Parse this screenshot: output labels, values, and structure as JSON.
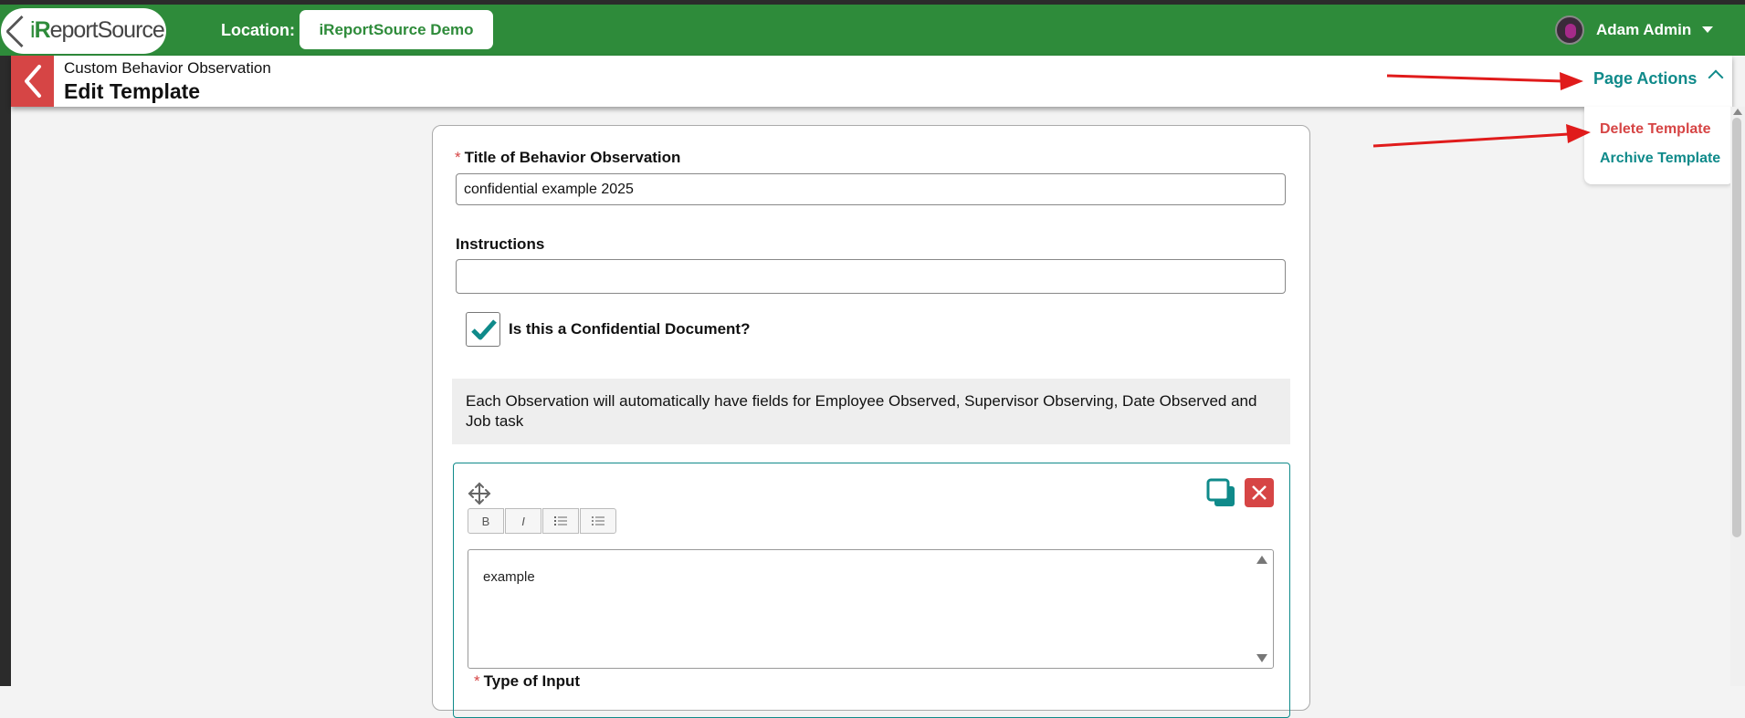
{
  "header": {
    "logo_text": "iReportSource",
    "location_label": "Location:",
    "location_value": "iReportSource Demo",
    "user_name": "Adam Admin"
  },
  "subheader": {
    "subtitle": "Custom Behavior Observation",
    "title": "Edit Template",
    "page_actions_label": "Page Actions"
  },
  "page_actions_menu": {
    "items": [
      {
        "label": "Delete Template",
        "color": "#d64545"
      },
      {
        "label": "Archive Template",
        "color": "#0f8a8a"
      }
    ]
  },
  "form": {
    "title_label": "Title of Behavior Observation",
    "required_mark": "*",
    "title_value": "confidential example 2025",
    "instructions_label": "Instructions",
    "instructions_value": "",
    "confidential_label": "Is this a Confidential Document?",
    "confidential_checked": true,
    "info_text": "Each Observation will automatically have fields for Employee Observed, Supervisor Observing, Date Observed and Job task",
    "field_editor": {
      "toolbar": [
        "B",
        "I",
        "ordered-list-icon",
        "unordered-list-icon"
      ],
      "text": "example",
      "type_label": "Type of Input"
    }
  },
  "colors": {
    "brand_green": "#2e8b3a",
    "accent_teal": "#0f8a8a",
    "danger_red": "#d64545",
    "annotation_arrow": "#e01b1b"
  }
}
